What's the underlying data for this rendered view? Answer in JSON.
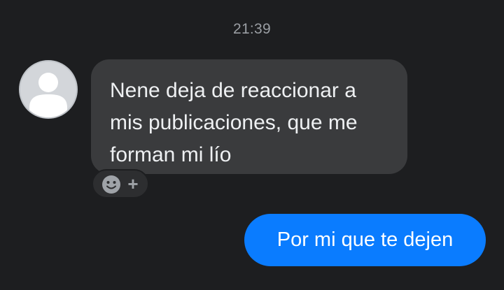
{
  "conversation": {
    "timestamp": "21:39",
    "incoming_message": {
      "text": "Nene deja de reaccionar a mis publicaciones, que me forman mi lío",
      "reaction_add": {
        "smiley_icon": "smiley-face-icon",
        "plus_label": "+"
      }
    },
    "outgoing_message": {
      "text": "Por mi que te dejen"
    }
  },
  "colors": {
    "background": "#1d1e20",
    "incoming_bubble": "#3a3b3d",
    "outgoing_bubble": "#0a7cff",
    "timestamp_text": "#9a9ea3"
  }
}
